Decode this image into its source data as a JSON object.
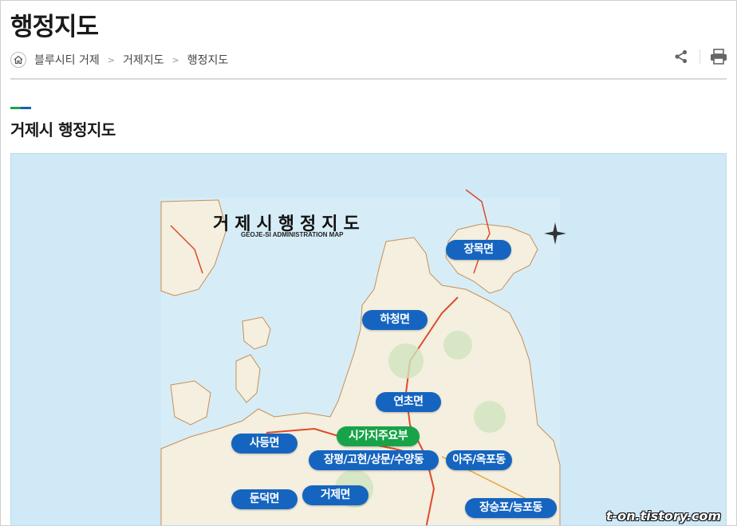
{
  "page": {
    "title": "행정지도"
  },
  "breadcrumb": {
    "home_icon": "home-icon",
    "items": [
      "블루시티 거제",
      "거제지도",
      "행정지도"
    ],
    "separator": ">"
  },
  "tools": {
    "share_icon": "share-icon",
    "print_icon": "print-icon"
  },
  "section": {
    "title": "거제시 행정지도",
    "accent_colors": [
      "#19a35a",
      "#1a5fb4"
    ]
  },
  "map": {
    "title": "거제시행정지도",
    "subtitle": "GEOJE-SI ADMINISTRATION MAP",
    "sea_color": "#cfe9f6",
    "land_color": "#f4efdf",
    "label_color": "#1565c0",
    "highlight_color": "#18a349",
    "regions": [
      {
        "id": "jangmok",
        "label": "장목면"
      },
      {
        "id": "hacheong",
        "label": "하청면"
      },
      {
        "id": "yeoncho",
        "label": "연초면"
      },
      {
        "id": "sigaji",
        "label": "시가지주요부"
      },
      {
        "id": "sadeung",
        "label": "사등면"
      },
      {
        "id": "jangpyeong",
        "label": "장평/고현/상문/수양동"
      },
      {
        "id": "aju",
        "label": "아주/옥포동"
      },
      {
        "id": "dundeok",
        "label": "둔덕면"
      },
      {
        "id": "geoje",
        "label": "거제면"
      },
      {
        "id": "jangseungpo",
        "label": "장승포/능포동"
      }
    ]
  },
  "watermark": "t-on.tistory.com"
}
